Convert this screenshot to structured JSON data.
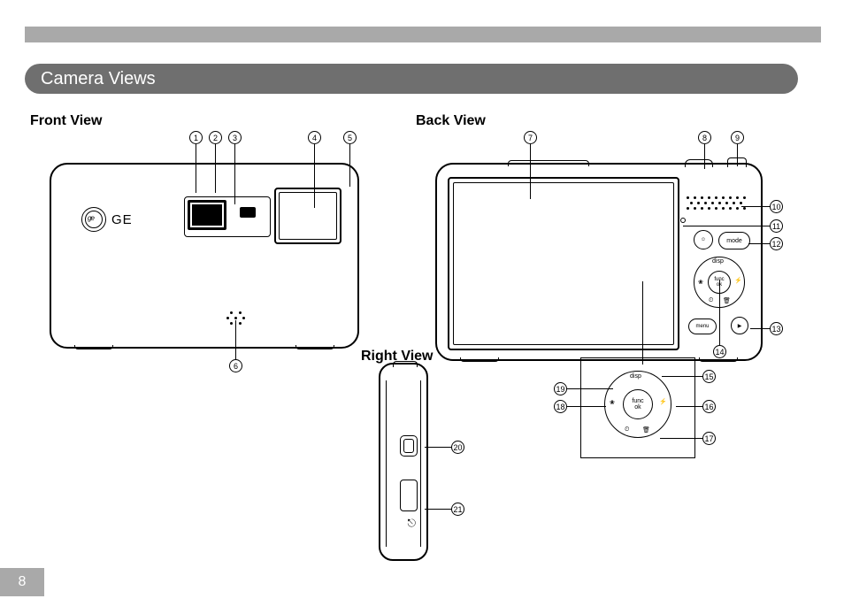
{
  "section_title": "Camera Views",
  "headings": {
    "front": "Front View",
    "back": "Back View",
    "right": "Right View"
  },
  "brand": "GE",
  "labels": {
    "func": "func\nok",
    "disp": "disp",
    "mode": "mode",
    "menu": "menu"
  },
  "page_number": "8",
  "callouts": {
    "c1": "1",
    "c2": "2",
    "c3": "3",
    "c4": "4",
    "c5": "5",
    "c6": "6",
    "c7": "7",
    "c8": "8",
    "c9": "9",
    "c10": "10",
    "c11": "11",
    "c12": "12",
    "c13": "13",
    "c14": "14",
    "c15": "15",
    "c16": "16",
    "c17": "17",
    "c18": "18",
    "c19": "19",
    "c20": "20",
    "c21": "21"
  },
  "chart_data": {
    "type": "table",
    "title": "Camera part callouts by view",
    "views": [
      {
        "name": "Front View",
        "callout_numbers": [
          1,
          2,
          3,
          4,
          5,
          6
        ]
      },
      {
        "name": "Back View",
        "callout_numbers": [
          7,
          8,
          9,
          10,
          11,
          12,
          13,
          14,
          15,
          16,
          17,
          18,
          19
        ]
      },
      {
        "name": "Right View",
        "callout_numbers": [
          20,
          21
        ]
      }
    ]
  }
}
